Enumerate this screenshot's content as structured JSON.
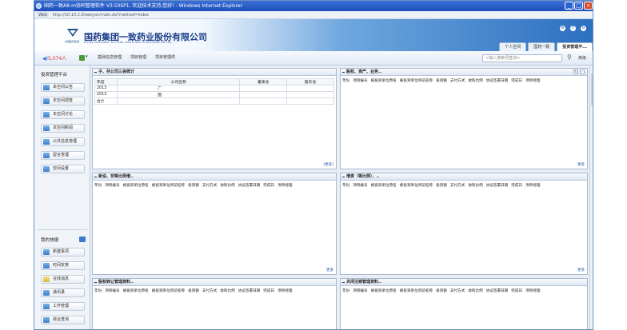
{
  "window": {
    "title": "国药一致A8-m协同管理软件 V3.50SP1, 欢迎技术支持,您好! - Windows Internet Explorer",
    "controls": [
      "_",
      "□",
      "×"
    ],
    "address": "http://10.10.2.0/seeyon/main.do?method=index",
    "address_prefix": "Web"
  },
  "header": {
    "company_cn": "国药集团一致药业股份有限公司",
    "company_en": "CHINA NATIONAL ACCORD MEDICINES CORPORATION LTD.",
    "logo_caption": "中国医药集团",
    "icons": [
      "gear-icon",
      "help-icon",
      "refresh-icon"
    ],
    "tabs": [
      {
        "label": "个人空间",
        "active": false
      },
      {
        "label": "国药一致",
        "active": false
      },
      {
        "label": "投资管理平...",
        "active": true
      }
    ]
  },
  "toolbar": {
    "user": "5,074人",
    "menu": [
      "基础信息管理",
      "项目管理",
      "项目管理供"
    ],
    "search_placeholder": "<输入搜索词查询>",
    "advanced": "高级"
  },
  "sidebar": {
    "title": "投资管理平台",
    "items": [
      "本空间公告",
      "本空间调查",
      "本空间讨论",
      "本空间新闻",
      "公共信息管理",
      "留言管理",
      "空间设置"
    ],
    "quick_title": "我的快捷",
    "quick_items": [
      "新建事项",
      "时间安排",
      "在线消息",
      "通讯录",
      "工作管理",
      "综合查询"
    ]
  },
  "panels": {
    "p1": {
      "title": "子、孙公司三会统计",
      "headers": [
        "年度",
        "公司名称",
        "董事会",
        "股东会"
      ],
      "rows": [
        [
          "2013",
          "广",
          "",
          ""
        ],
        [
          "2013",
          "国",
          "",
          ""
        ],
        [
          "合计",
          "",
          "",
          ""
        ]
      ],
      "more": "[更多]"
    },
    "p2": {
      "title": "股权、资产、业务..",
      "more": "更多"
    },
    "p3": {
      "title": "新设、非等比例增..",
      "more": "更多"
    },
    "p4": {
      "title": "增资（等比例）、..",
      "more": "更多"
    },
    "p5": {
      "title": "股权转让管理资料..",
      "more": "更多"
    },
    "p6": {
      "title": "关闭注销管理资料..",
      "more": "更多"
    },
    "columns": [
      "年份",
      "项目编号",
      "被投资单位原名",
      "被投资单位目前名称",
      "投资额",
      "支付方式",
      "收购比例",
      "协议签署日期",
      "完成日",
      "项目经理"
    ]
  }
}
